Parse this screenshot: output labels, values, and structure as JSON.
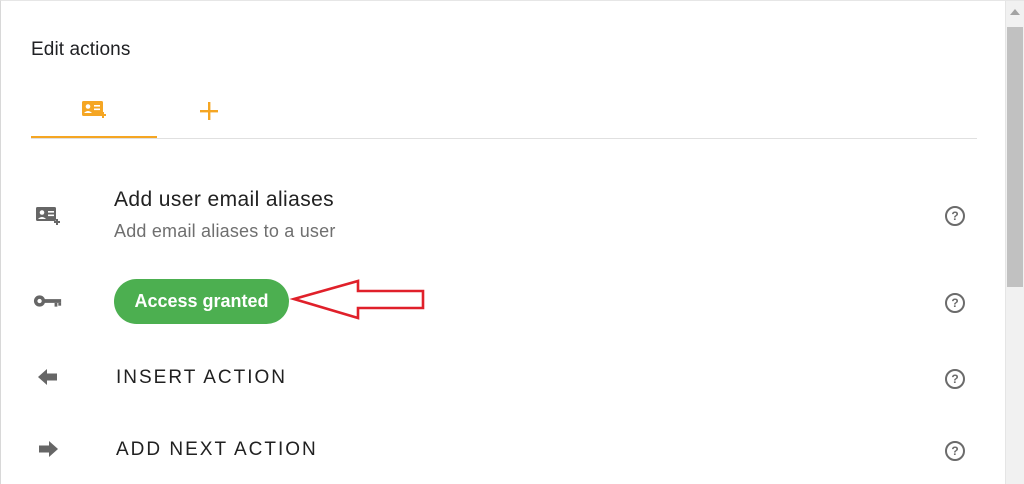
{
  "panel": {
    "title": "Edit actions"
  },
  "tabs": [
    {
      "icon": "contact-card-add-icon",
      "active": true
    },
    {
      "icon": "plus-icon",
      "active": false
    }
  ],
  "rows": {
    "user_email_aliases": {
      "title": "Add user email aliases",
      "subtitle": "Add email aliases to a user",
      "icon": "contact-card-add-icon"
    },
    "access": {
      "badge": "Access granted",
      "icon": "key-icon"
    },
    "insert": {
      "label": "INSERT ACTION",
      "icon": "arrow-left-icon"
    },
    "next": {
      "label": "ADD NEXT ACTION",
      "icon": "arrow-right-icon"
    }
  },
  "help_symbol": "?",
  "colors": {
    "accent": "#f5a623",
    "badge_green": "#4caf50",
    "annotation_red": "#e0202a",
    "icon_gray": "#666666"
  }
}
